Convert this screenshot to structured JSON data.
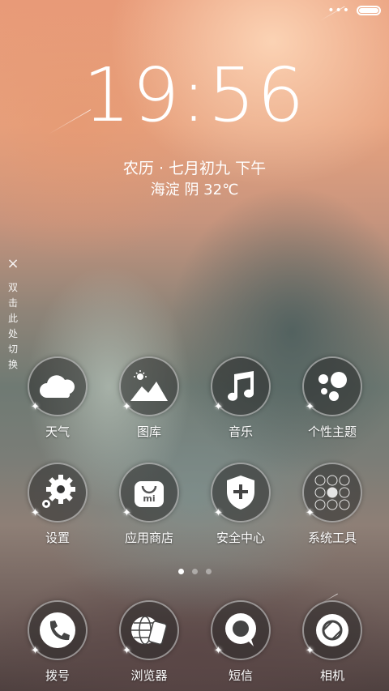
{
  "status_bar": {
    "dots": "•••",
    "battery_level": 1.0
  },
  "lockscreen": {
    "time": "19:56",
    "lunar_date": "农历 · 七月初九  下午",
    "weather": "海淀  阴  32℃",
    "hint_close": "×",
    "hint_chars": [
      "双",
      "击",
      "此",
      "处",
      "切",
      "换"
    ]
  },
  "apps": [
    {
      "label": "天气",
      "icon": "weather-cloud-icon"
    },
    {
      "label": "图库",
      "icon": "gallery-icon"
    },
    {
      "label": "音乐",
      "icon": "music-note-icon"
    },
    {
      "label": "个性主题",
      "icon": "theme-icon"
    },
    {
      "label": "设置",
      "icon": "settings-gear-icon"
    },
    {
      "label": "应用商店",
      "icon": "app-store-bag-icon"
    },
    {
      "label": "安全中心",
      "icon": "security-shield-icon"
    },
    {
      "label": "系统工具",
      "icon": "system-tools-icon"
    }
  ],
  "pager": {
    "pages": 3,
    "active": 0
  },
  "dock": [
    {
      "label": "拨号",
      "icon": "phone-icon"
    },
    {
      "label": "浏览器",
      "icon": "browser-icon"
    },
    {
      "label": "短信",
      "icon": "message-bubble-icon"
    },
    {
      "label": "相机",
      "icon": "camera-icon"
    }
  ],
  "colors": {
    "accent": "#ffffff",
    "icon_bg": "#333333"
  }
}
